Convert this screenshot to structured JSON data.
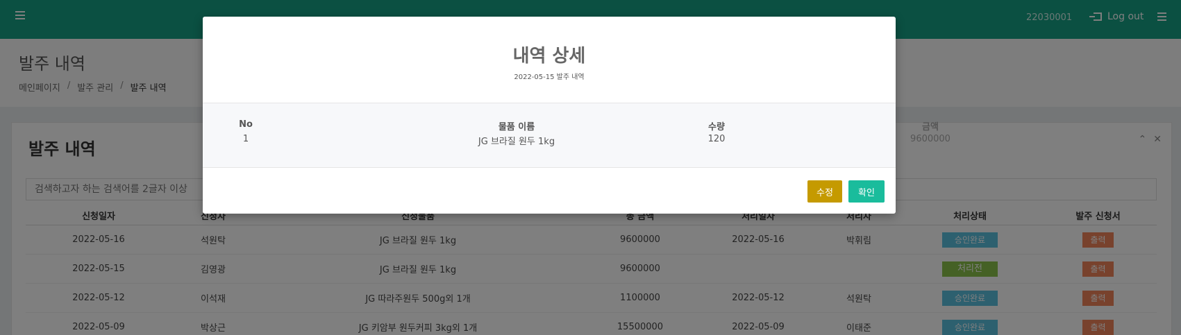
{
  "topbar": {
    "user_id": "22030001",
    "logout_label": "Log out"
  },
  "page": {
    "title": "발주 내역",
    "breadcrumb": [
      "메인페이지",
      "발주 관리",
      "발주 내역"
    ]
  },
  "card": {
    "title": "발주 내역",
    "search_placeholder": "검색하고자 하는 검색어를 2글자 이상",
    "columns": [
      "신청일자",
      "신청자",
      "신청물품",
      "총 금액",
      "처리일자",
      "처리자",
      "처리상태",
      "발주 신청서"
    ],
    "rows": [
      {
        "date": "2022-05-16",
        "requester": "석원탁",
        "item": "JG 브라질 원두 1kg",
        "total": "9600000",
        "processed_date": "2022-05-16",
        "processor": "박휘림",
        "status": "승인완료",
        "status_color": "#5bc0de",
        "print": "출력"
      },
      {
        "date": "2022-05-15",
        "requester": "김영광",
        "item": "JG 브라질 원두 1kg",
        "total": "9600000",
        "processed_date": "",
        "processor": "",
        "status": "처리전",
        "status_color": "#8bc34a",
        "print": "출력"
      },
      {
        "date": "2022-05-12",
        "requester": "이석재",
        "item": "JG 따라주원두 500g외 1개",
        "total": "1100000",
        "processed_date": "2022-05-12",
        "processor": "석원탁",
        "status": "승인완료",
        "status_color": "#5bc0de",
        "print": "출력"
      },
      {
        "date": "2022-05-09",
        "requester": "박상근",
        "item": "JG 키암부 원두커피 3kg외 1개",
        "total": "15500000",
        "processed_date": "2022-05-09",
        "processor": "이태준",
        "status": "승인완료",
        "status_color": "#5bc0de",
        "print": "출력"
      }
    ]
  },
  "modal": {
    "title": "내역 상세",
    "subtitle": "2022-05-15 발주 내역",
    "headers": {
      "no": "No",
      "name": "물품 이름",
      "qty": "수량",
      "amount": "금액"
    },
    "row": {
      "no": "1",
      "name": "JG 브라질 원두 1kg",
      "qty": "120",
      "amount": "9600000"
    },
    "edit_label": "수정",
    "ok_label": "확인"
  },
  "colors": {
    "topbar": "#16a085",
    "edit_button": "#c59a00",
    "ok_button": "#1abc9c",
    "print_badge": "#f0855a"
  }
}
